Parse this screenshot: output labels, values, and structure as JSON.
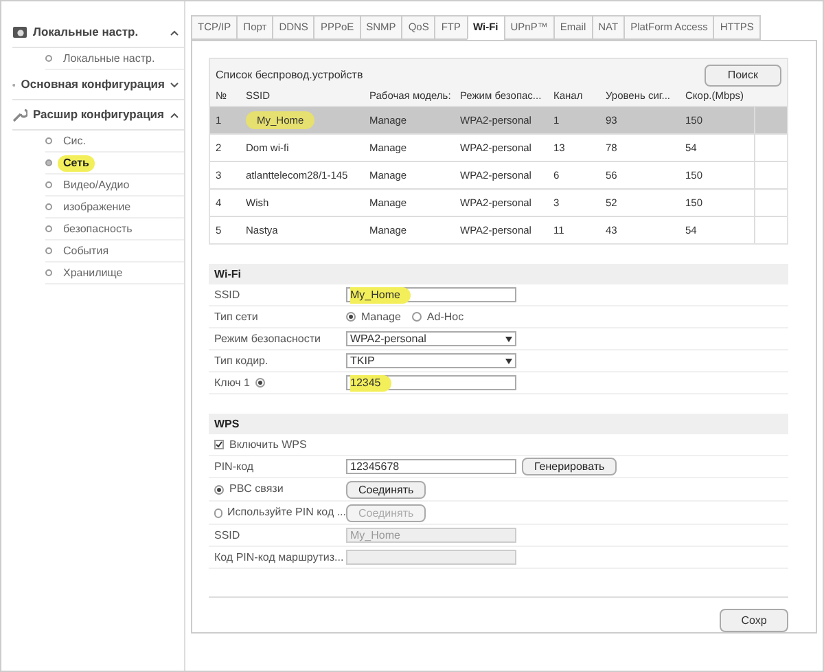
{
  "sidebar": {
    "groups": [
      {
        "label": "Локальные настр.",
        "expanded": true,
        "items": [
          {
            "label": "Локальные настр.",
            "selected": false,
            "highlighted": false
          }
        ]
      },
      {
        "label": "Основная конфигурация",
        "expanded": false
      },
      {
        "label": "Расшир конфигурация",
        "expanded": true,
        "items": [
          {
            "label": "Сис.",
            "selected": false,
            "highlighted": false
          },
          {
            "label": "Сеть",
            "selected": true,
            "highlighted": true
          },
          {
            "label": "Видео/Аудио",
            "selected": false,
            "highlighted": false
          },
          {
            "label": "изображение",
            "selected": false,
            "highlighted": false
          },
          {
            "label": "безопасность",
            "selected": false,
            "highlighted": false
          },
          {
            "label": "События",
            "selected": false,
            "highlighted": false
          },
          {
            "label": "Хранилище",
            "selected": false,
            "highlighted": false
          }
        ]
      }
    ]
  },
  "tabs": [
    {
      "label": "TCP/IP",
      "selected": false
    },
    {
      "label": "Порт",
      "selected": false
    },
    {
      "label": "DDNS",
      "selected": false
    },
    {
      "label": "PPPoE",
      "selected": false
    },
    {
      "label": "SNMP",
      "selected": false
    },
    {
      "label": "QoS",
      "selected": false
    },
    {
      "label": "FTP",
      "selected": false
    },
    {
      "label": "Wi-Fi",
      "selected": true
    },
    {
      "label": "UPnP™",
      "selected": false
    },
    {
      "label": "Email",
      "selected": false
    },
    {
      "label": "NAT",
      "selected": false
    },
    {
      "label": "PlatForm Access",
      "selected": false
    },
    {
      "label": "HTTPS",
      "selected": false
    }
  ],
  "device_list": {
    "title": "Список беспровод.устройств",
    "search_button": "Поиск",
    "columns": [
      "№",
      "SSID",
      "Рабочая модель:",
      "Режим безопас...",
      "Канал",
      "Уровень сиг...",
      "Скор.(Mbps)"
    ],
    "rows": [
      {
        "cells": [
          "1",
          "My_Home",
          "Manage",
          "WPA2-personal",
          "1",
          "93",
          "150"
        ],
        "selected": true,
        "highlighted": true
      },
      {
        "cells": [
          "2",
          "Dom wi-fi",
          "Manage",
          "WPA2-personal",
          "13",
          "78",
          "54"
        ],
        "selected": false,
        "highlighted": false
      },
      {
        "cells": [
          "3",
          "atlanttelecom28/1-145",
          "Manage",
          "WPA2-personal",
          "6",
          "56",
          "150"
        ],
        "selected": false,
        "highlighted": false
      },
      {
        "cells": [
          "4",
          "Wish",
          "Manage",
          "WPA2-personal",
          "3",
          "52",
          "150"
        ],
        "selected": false,
        "highlighted": false
      },
      {
        "cells": [
          "5",
          "Nastya",
          "Manage",
          "WPA2-personal",
          "11",
          "43",
          "54"
        ],
        "selected": false,
        "highlighted": false
      }
    ]
  },
  "wifi": {
    "title": "Wi-Fi",
    "rows": [
      {
        "kind": "text",
        "label": "SSID",
        "value": "My_Home",
        "highlighted": true
      },
      {
        "kind": "radios",
        "label": "Тип сети",
        "options": [
          {
            "label": "Manage",
            "selected": true
          },
          {
            "label": "Ad-Hoc",
            "selected": false
          }
        ]
      },
      {
        "kind": "select",
        "label": "Режим безопасности",
        "value": "WPA2-personal"
      },
      {
        "kind": "select",
        "label": "Тип кодир.",
        "value": "TKIP"
      },
      {
        "kind": "key",
        "label": "Ключ 1",
        "selected": true,
        "value": "12345",
        "highlighted": true
      }
    ]
  },
  "wps": {
    "title": "WPS",
    "rows": [
      {
        "kind": "checkbox",
        "label": "Включить WPS",
        "checked": true
      },
      {
        "kind": "text-button",
        "label": "PIN-код",
        "value": "12345678",
        "button": "Генерировать"
      },
      {
        "kind": "radio-button",
        "label": "PBC связи",
        "selected": true,
        "button": "Соединять",
        "disabled": false
      },
      {
        "kind": "radio-button",
        "label": "Используйте PIN код ...",
        "selected": false,
        "button": "Соединять",
        "disabled": true
      },
      {
        "kind": "text",
        "label": "SSID",
        "value": "My_Home",
        "disabled": true
      },
      {
        "kind": "text",
        "label": "Код PIN-код маршрутиз...",
        "value": "",
        "disabled": true
      }
    ]
  },
  "save_button": "Сохр"
}
